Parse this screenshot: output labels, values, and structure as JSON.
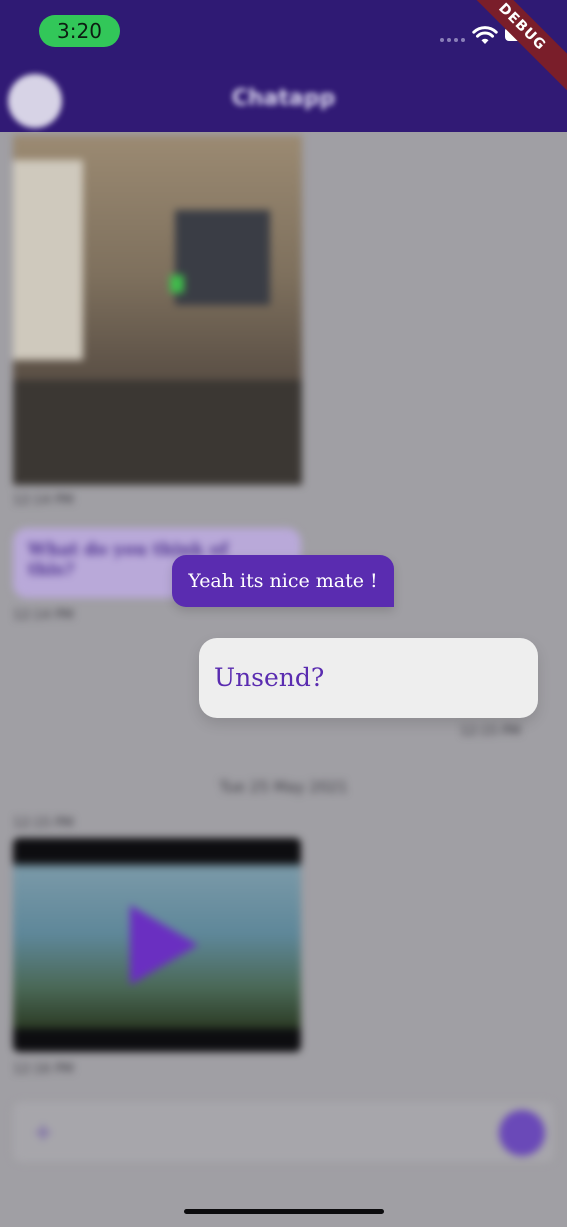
{
  "status_bar": {
    "time": "3:20",
    "debug_label": "DEBUG"
  },
  "app_bar": {
    "title": "Chatapp"
  },
  "chat": {
    "incoming_text": "What do you think of this?",
    "timestamp_1": "12:14 PM",
    "timestamp_2": "12:14 PM",
    "timestamp_3": "12:15 PM",
    "date_separator": "Tue 25 May 2021",
    "video_top_time": "12:15 PM",
    "video_time": "12:16 PM"
  },
  "focused_message": {
    "text": "Yeah its nice mate !"
  },
  "context_menu": {
    "unsend_label": "Unsend?"
  },
  "input": {
    "attach_glyph": "+"
  },
  "colors": {
    "primary": "#311a75",
    "accent": "#5a2cb0",
    "status_green": "#32c759"
  }
}
